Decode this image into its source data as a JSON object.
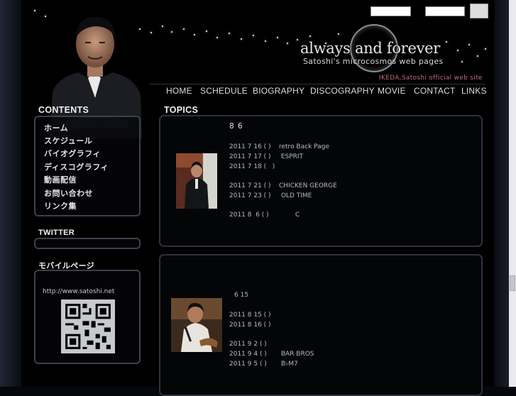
{
  "header": {
    "logo_text": "always and forever",
    "subtitle": "Satoshi's microcosmos web pages",
    "official": "IKEDA,Satoshi official web site"
  },
  "nav": {
    "items": [
      "HOME",
      "SCHEDULE",
      "BIOGRAPHY",
      "DISCOGRAPHY",
      "MOVIE",
      "CONTACT",
      "LINKS"
    ]
  },
  "sidebar": {
    "contents_heading": "CONTENTS",
    "menu": [
      "ホーム",
      "スケジュール",
      "バイオグラフィ",
      "ディスコグラフィ",
      "動画配信",
      "お問い合わせ",
      "リンク集"
    ],
    "twitter_heading": "TWITTER",
    "mobile_heading": "モバイルページ",
    "mobile_url": "http://www.satoshi.net"
  },
  "topics": {
    "heading": "TOPICS",
    "entries": [
      {
        "title": "8 6",
        "lines": [
          "2011 7 16 ( )    retro Back Page",
          "2011 7 17 ( )     ESPRIT",
          "2011 7 18 (   )",
          "",
          "2011 7 21 ( )    CHICKEN GEORGE",
          "2011 7 23 ( )     OLD TIME",
          "",
          "2011 8  6 ( )             C"
        ]
      },
      {
        "title": "6 15",
        "lines": [
          "2011 8 15 ( )",
          "2011 8 16 ( )",
          "",
          "",
          "2011 9 2 ( )",
          "2011 9 4 ( )       BAR BROS",
          "2011 9 5 ( )       B♭M7"
        ]
      }
    ]
  },
  "colors": {
    "background": "#000000",
    "panel_border": "#3c414a",
    "official_text": "#c26a7e"
  }
}
